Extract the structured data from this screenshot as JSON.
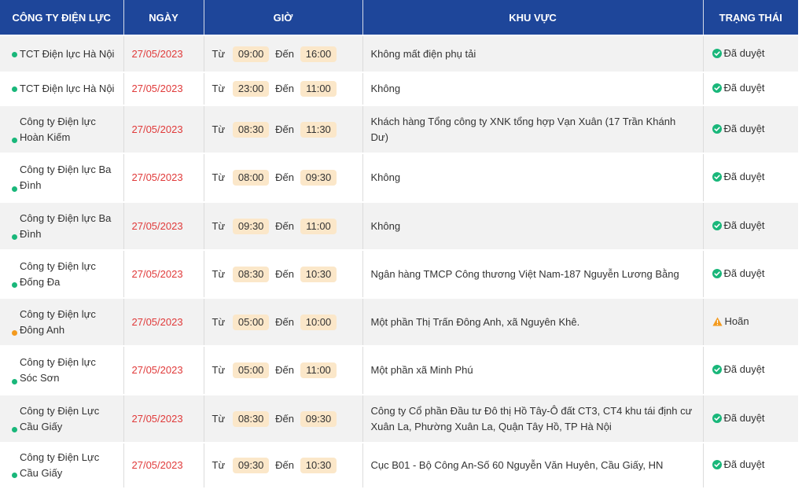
{
  "header": {
    "company": "CÔNG TY ĐIỆN LỰC",
    "date": "NGÀY",
    "time": "GIỜ",
    "area": "KHU VỰC",
    "status": "TRẠNG THÁI"
  },
  "labels": {
    "from": "Từ",
    "to": "Đến"
  },
  "colors": {
    "header_bg": "#1e469a",
    "date_text": "#e03a3a",
    "time_pill": "#fbe7c9",
    "approved": "#19b77a",
    "postponed": "#f39a1e"
  },
  "rows": [
    {
      "company": "TCT Điện lực Hà Nội",
      "date": "27/05/2023",
      "from": "09:00",
      "to": "16:00",
      "area": "Không mất điện phụ tải",
      "status": "Đã duyệt",
      "status_icon": "check-circle-icon"
    },
    {
      "company": "TCT Điện lực Hà Nội",
      "date": "27/05/2023",
      "from": "23:00",
      "to": "11:00",
      "area": "Không",
      "status": "Đã duyệt",
      "status_icon": "check-circle-icon"
    },
    {
      "company": "Công ty Điện lực Hoàn Kiếm",
      "date": "27/05/2023",
      "from": "08:30",
      "to": "11:30",
      "area": "Khách hàng Tổng công ty XNK tổng hợp Vạn Xuân (17 Trần Khánh Dư)",
      "status": "Đã duyệt",
      "status_icon": "check-circle-icon"
    },
    {
      "company": "Công ty Điện lực Ba Đình",
      "date": "27/05/2023",
      "from": "08:00",
      "to": "09:30",
      "area": "Không",
      "status": "Đã duyệt",
      "status_icon": "check-circle-icon"
    },
    {
      "company": "Công ty Điện lực Ba Đình",
      "date": "27/05/2023",
      "from": "09:30",
      "to": "11:00",
      "area": "Không",
      "status": "Đã duyệt",
      "status_icon": "check-circle-icon"
    },
    {
      "company": "Công ty Điện lực Đống Đa",
      "date": "27/05/2023",
      "from": "08:30",
      "to": "10:30",
      "area": "Ngân hàng TMCP Công thương Việt Nam-187 Nguyễn Lương Bằng",
      "status": "Đã duyệt",
      "status_icon": "check-circle-icon"
    },
    {
      "company": "Công ty Điện lực Đông Anh",
      "date": "27/05/2023",
      "from": "05:00",
      "to": "10:00",
      "area": "Một phần Thị Trấn Đông Anh, xã Nguyên Khê.",
      "status": "Hoãn",
      "status_icon": "warning-icon"
    },
    {
      "company": "Công ty Điện lực Sóc Sơn",
      "date": "27/05/2023",
      "from": "05:00",
      "to": "11:00",
      "area": "Một phần xã Minh Phú",
      "status": "Đã duyệt",
      "status_icon": "check-circle-icon"
    },
    {
      "company": "Công ty Điện Lực Cầu Giấy",
      "date": "27/05/2023",
      "from": "08:30",
      "to": "09:30",
      "area": "Công ty Cổ phần Đầu tư Đô thị Hồ Tây-Ô đất CT3, CT4 khu tái định cư Xuân La, Phường Xuân La, Quận Tây Hồ, TP Hà Nội",
      "status": "Đã duyệt",
      "status_icon": "check-circle-icon"
    },
    {
      "company": "Công ty Điện Lực Cầu Giấy",
      "date": "27/05/2023",
      "from": "09:30",
      "to": "10:30",
      "area": "Cục B01 - Bộ Công An-Số 60 Nguyễn Văn Huyên, Cầu Giấy, HN",
      "status": "Đã duyệt",
      "status_icon": "check-circle-icon"
    }
  ]
}
